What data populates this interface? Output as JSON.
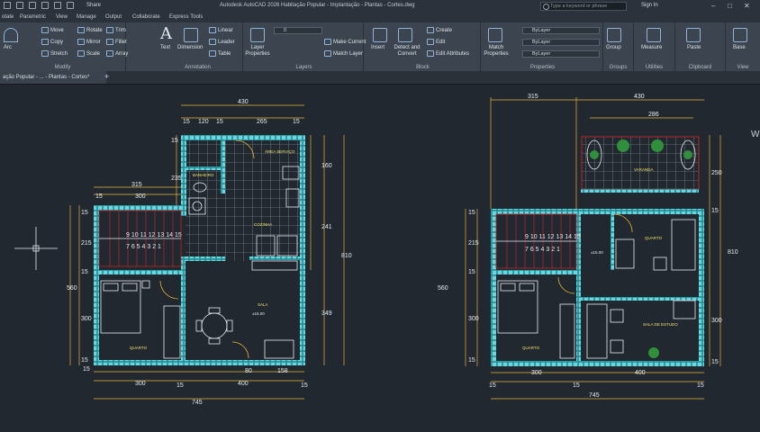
{
  "app": {
    "title": "Autodesk AutoCAD 2026   Habitação Popular - Implantação - Plantas - Cortes.dwg",
    "share": "Share",
    "search_placeholder": "Type a keyword or phrase",
    "sign_in": "Sign In",
    "minimize": "–",
    "maximize": "□",
    "close": "✕"
  },
  "ribbon_tabs": [
    "otate",
    "Parametric",
    "View",
    "Manage",
    "Output",
    "Collaborate",
    "Express Tools"
  ],
  "ribbon": {
    "draw": {
      "arc": "Arc"
    },
    "modify": {
      "label": "Modify",
      "move": "Move",
      "rotate": "Rotate",
      "trim": "Trim",
      "copy": "Copy",
      "mirror": "Mirror",
      "fillet": "Fillet",
      "stretch": "Stretch",
      "scale": "Scale",
      "array": "Array"
    },
    "annotation": {
      "label": "Annotation",
      "text": "Text",
      "dimension": "Dimension",
      "linear": "Linear",
      "leader": "Leader",
      "table": "Table"
    },
    "layers": {
      "label": "Layers",
      "layer_properties": "Layer Properties",
      "current_layer": "0",
      "make_current": "Make Current",
      "match_layer": "Match Layer"
    },
    "block": {
      "label": "Block",
      "insert": "Insert",
      "detect": "Detect and Convert",
      "create": "Create",
      "edit": "Edit",
      "edit_attributes": "Edit Attributes"
    },
    "properties": {
      "label": "Properties",
      "match_properties": "Match Properties",
      "bylayer1": "ByLayer",
      "bylayer2": "ByLayer",
      "bylayer3": "ByLayer"
    },
    "groups": {
      "label": "Groups",
      "group": "Group"
    },
    "utilities": {
      "label": "Utilities",
      "measure": "Measure"
    },
    "clipboard": {
      "label": "Clipboard",
      "paste": "Paste"
    },
    "view": {
      "label": "View",
      "base": "Base"
    }
  },
  "document_tab": "ação Popular - ... - Plantas - Cortes*",
  "new_tab": "+",
  "drawing": {
    "plan1": {
      "dims_top": [
        "430",
        "15",
        "120",
        "15",
        "265",
        "15"
      ],
      "dims_left_top": [
        "315",
        "15",
        "300"
      ],
      "dims_bottom": [
        "15",
        "300",
        "15",
        "400",
        "15",
        "745"
      ],
      "dims_bottom_inner": [
        "80",
        "158"
      ],
      "dims_left_vertical": [
        "15",
        "215",
        "15",
        "560",
        "300",
        "15"
      ],
      "dims_upper_left": [
        "15",
        "235"
      ],
      "dims_right": [
        "160",
        "241",
        "810",
        "349"
      ],
      "rooms": {
        "area_servico": "ÁREA SERVIÇO",
        "banheiro": "BANHEIRO",
        "cozinha": "COZINHA",
        "sala": "SALA",
        "quarto": "QUARTO"
      },
      "level": "±15.00",
      "stairs_top": "9 10 11 12 13 14 15",
      "stairs_bottom": "7 6 5 4 3 2 1"
    },
    "plan2": {
      "dims_top": [
        "315",
        "430",
        "286"
      ],
      "dims_bottom": [
        "15",
        "300",
        "15",
        "400",
        "15",
        "745"
      ],
      "dims_left_vertical": [
        "15",
        "215",
        "15",
        "560",
        "300",
        "15"
      ],
      "dims_right": [
        "250",
        "15",
        "810",
        "300",
        "15"
      ],
      "rooms": {
        "varanda": "VARANDA",
        "quarto1": "QUARTO",
        "quarto2": "QUARTO",
        "sala_estudo": "SALA DE ESTUDO"
      },
      "level": "±15.00",
      "stairs_top": "9 10 11 12 13 14 15",
      "stairs_bottom": "7 6 5 4 3 2 1"
    },
    "viewcube_letter": "W"
  },
  "colors": {
    "canvas": "#212830",
    "wall": "#6fd4dc",
    "wall_dark": "#1e8e97",
    "dimension": "#e8b43a",
    "line_white": "#e6ebef",
    "stair_red": "#c02424",
    "room_text": "#f1e36a"
  }
}
